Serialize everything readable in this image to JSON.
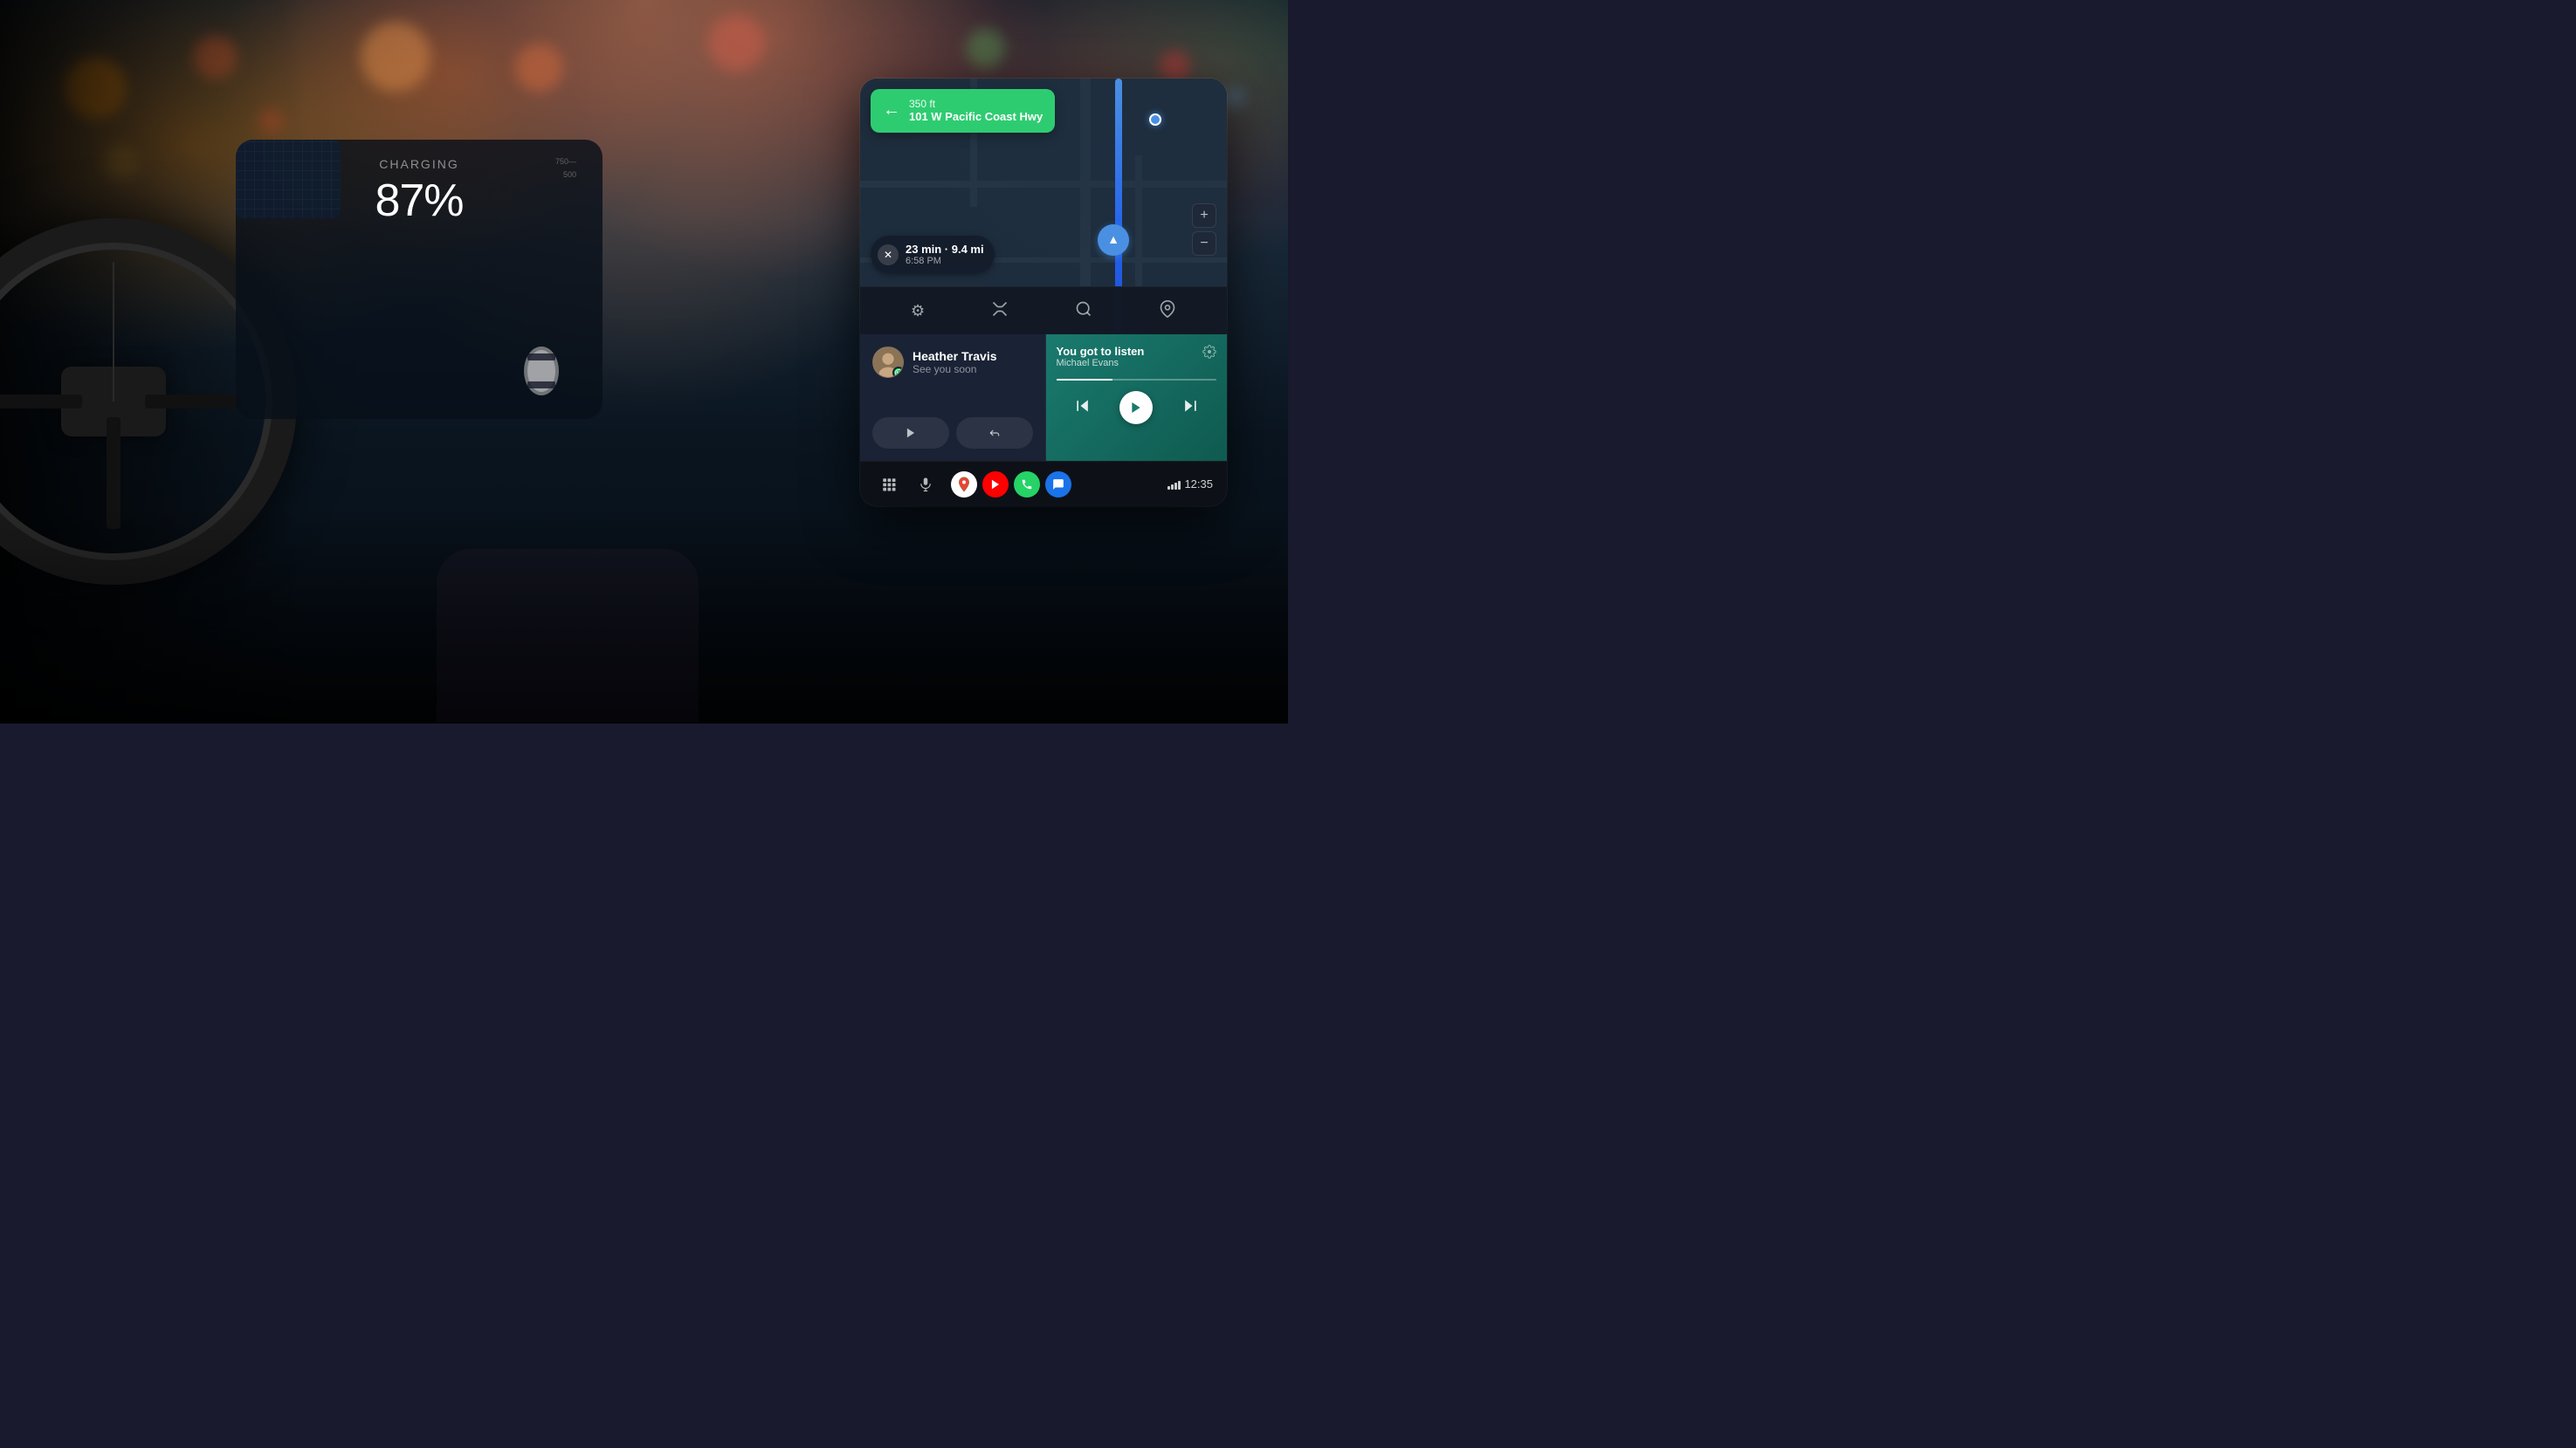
{
  "scene": {
    "background": "car interior at night with bokeh lights",
    "cluster": {
      "label": "Charging",
      "battery": "87%"
    }
  },
  "android_auto": {
    "navigation": {
      "turn": {
        "distance": "350 ft",
        "street": "101 W Pacific Coast Hwy",
        "arrow": "←"
      },
      "eta": {
        "time": "23 min · 9.4 mi",
        "arrival": "6:58 PM"
      },
      "toolbar": {
        "settings_icon": "⚙",
        "routes_icon": "⇄",
        "search_icon": "🔍",
        "pin_icon": "📍",
        "zoom_in": "+",
        "zoom_out": "−"
      }
    },
    "message": {
      "contact_name": "Heather Travis",
      "message_text": "See you soon",
      "app_badge": "whatsapp",
      "play_label": "▶",
      "reply_label": "↩"
    },
    "music": {
      "song_title": "You got to listen",
      "artist": "Michael Evans",
      "settings_icon": "⚙",
      "prev_label": "⏮",
      "play_label": "▶",
      "next_label": "⏭",
      "progress_percent": 35
    },
    "system_bar": {
      "grid_icon": "⊞",
      "mic_icon": "🎤",
      "apps": [
        {
          "name": "Google Maps",
          "id": "maps"
        },
        {
          "name": "YouTube Music",
          "id": "youtube"
        },
        {
          "name": "Phone",
          "id": "phone"
        },
        {
          "name": "Messages",
          "id": "messages"
        }
      ],
      "time": "12:35",
      "signal": 4
    }
  }
}
